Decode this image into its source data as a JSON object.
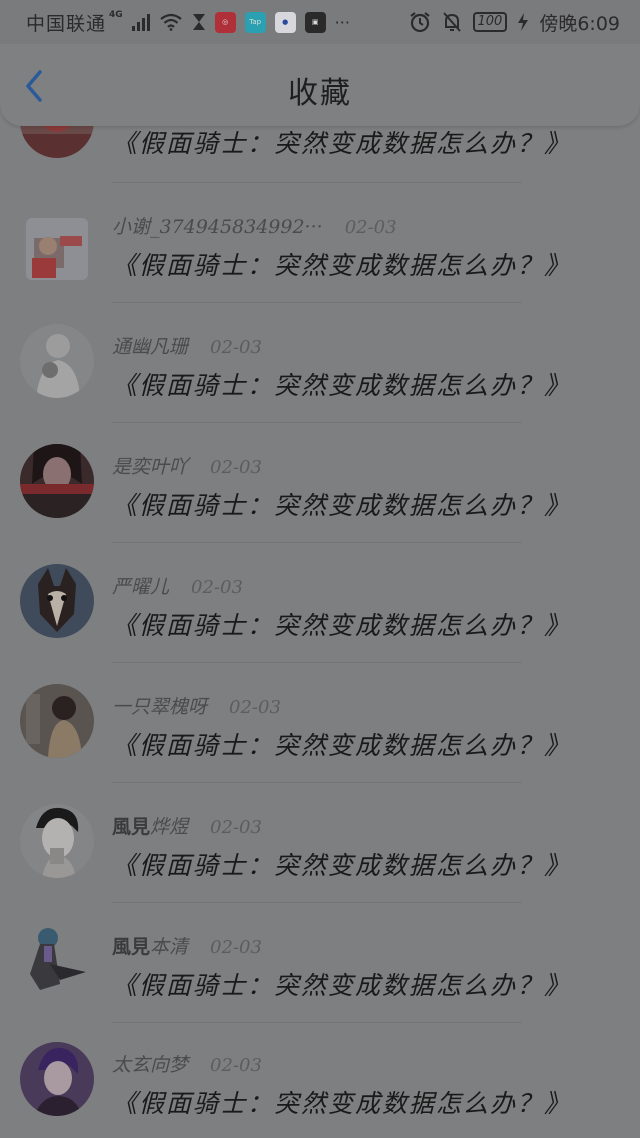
{
  "status_bar": {
    "carrier": "中国联通",
    "network_type": "4G",
    "battery": "100",
    "time": "傍晚6:09",
    "more": "···",
    "app_icons": [
      "netease-music-icon",
      "taptap-icon",
      "baidu-icon",
      "app-icon"
    ]
  },
  "header": {
    "title": "收藏",
    "back_icon": "chevron-left-icon"
  },
  "items": [
    {
      "username": "",
      "username_bold": "",
      "date": "",
      "title": "《假面骑士：突然变成数据怎么办？》"
    },
    {
      "username": "小谢_374945834992···",
      "username_bold": "",
      "date": "02-03",
      "title": "《假面骑士：突然变成数据怎么办？》"
    },
    {
      "username": "通幽凡珊",
      "username_bold": "",
      "date": "02-03",
      "title": "《假面骑士：突然变成数据怎么办？》"
    },
    {
      "username": "是奕叶吖",
      "username_bold": "",
      "date": "02-03",
      "title": "《假面骑士：突然变成数据怎么办？》"
    },
    {
      "username": "严曜儿",
      "username_bold": "",
      "date": "02-03",
      "title": "《假面骑士：突然变成数据怎么办？》"
    },
    {
      "username": "一只翠槐呀",
      "username_bold": "",
      "date": "02-03",
      "title": "《假面骑士：突然变成数据怎么办？》"
    },
    {
      "username": "烨煜",
      "username_bold": "風見",
      "date": "02-03",
      "title": "《假面骑士：突然变成数据怎么办？》"
    },
    {
      "username": "本清",
      "username_bold": "風見",
      "date": "02-03",
      "title": "《假面骑士：突然变成数据怎么办？》"
    },
    {
      "username": "太玄向梦",
      "username_bold": "",
      "date": "02-03",
      "title": "《假面骑士：突然变成数据怎么办？》"
    }
  ]
}
